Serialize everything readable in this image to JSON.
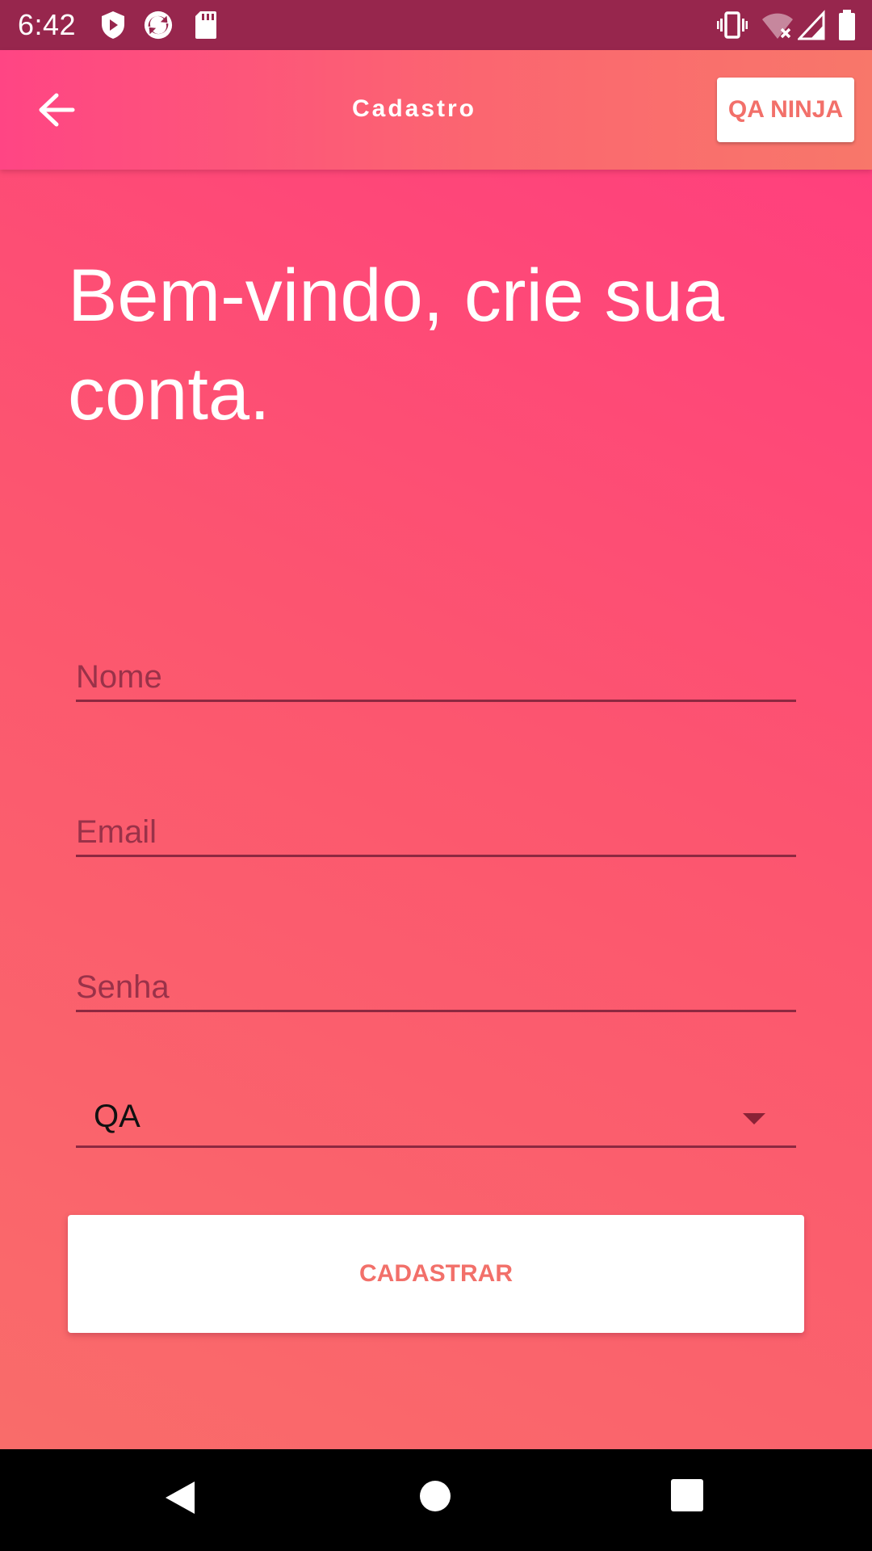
{
  "status_bar": {
    "time": "6:42",
    "icons_left": [
      "shield-play-icon",
      "sync-icon",
      "sd-card-icon"
    ],
    "icons_right": [
      "vibrate-icon",
      "wifi-off-icon",
      "signal-icon",
      "battery-icon"
    ]
  },
  "app_bar": {
    "back_icon": "arrow-left-icon",
    "title": "Cadastro",
    "action_label": "QA NINJA"
  },
  "main": {
    "headline": "Bem-vindo, crie sua conta.",
    "fields": {
      "name_placeholder": "Nome",
      "email_placeholder": "Email",
      "password_placeholder": "Senha"
    },
    "role_select": {
      "selected": "QA"
    },
    "submit_label": "CADASTRAR"
  },
  "nav_bar": {
    "buttons": [
      "back-triangle-icon",
      "home-circle-icon",
      "recents-square-icon"
    ]
  },
  "colors": {
    "status_bar": "#97264d",
    "gradient_pink": "#ff407d",
    "gradient_coral": "#f96c6a",
    "button_text": "#f2706a"
  }
}
